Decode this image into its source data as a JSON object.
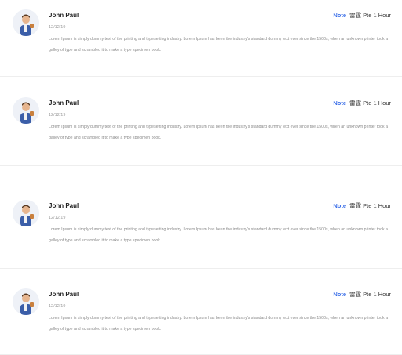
{
  "reviews": [
    {
      "name": "John Paul",
      "date": "12/12/19",
      "note_label": "Note",
      "time": "雷霆 Pte 1 Hour",
      "text": "Lorem Ipsum is simply dummy text of the printing and typesetting industry. Lorem Ipsum has been the industry's standard dummy text ever since the 1500s, when an unknown printer took a galley of type and scrambled it to make a type specimen book."
    },
    {
      "name": "John Paul",
      "date": "12/12/19",
      "note_label": "Note",
      "time": "雷霆 Pte 1 Hour",
      "text": "Lorem Ipsum is simply dummy text of the printing and typesetting industry. Lorem Ipsum has been the industry's standard dummy text ever since the 1500s, when an unknown printer took a galley of type and scrambled it to make a type specimen book."
    },
    {
      "name": "John Paul",
      "date": "12/12/19",
      "note_label": "Note",
      "time": "雷霆 Pte 1 Hour",
      "text": "Lorem Ipsum is simply dummy text of the printing and typesetting industry. Lorem Ipsum has been the industry's standard dummy text ever since the 1500s, when an unknown printer took a galley of type and scrambled it to make a type specimen book."
    },
    {
      "name": "John Paul",
      "date": "12/12/19",
      "note_label": "Note",
      "time": "雷霆 Pte 1 Hour",
      "text": "Lorem Ipsum is simply dummy text of the printing and typesetting industry. Lorem Ipsum has been the industry's standard dummy text ever since the 1500s, when an unknown printer took a galley of type and scrambled it to make a type specimen book."
    }
  ],
  "colors": {
    "accent": "#3a6ee8",
    "name": "#222222",
    "muted": "#8a8a8a"
  },
  "icons": {
    "avatar": "person-avatar-icon"
  }
}
